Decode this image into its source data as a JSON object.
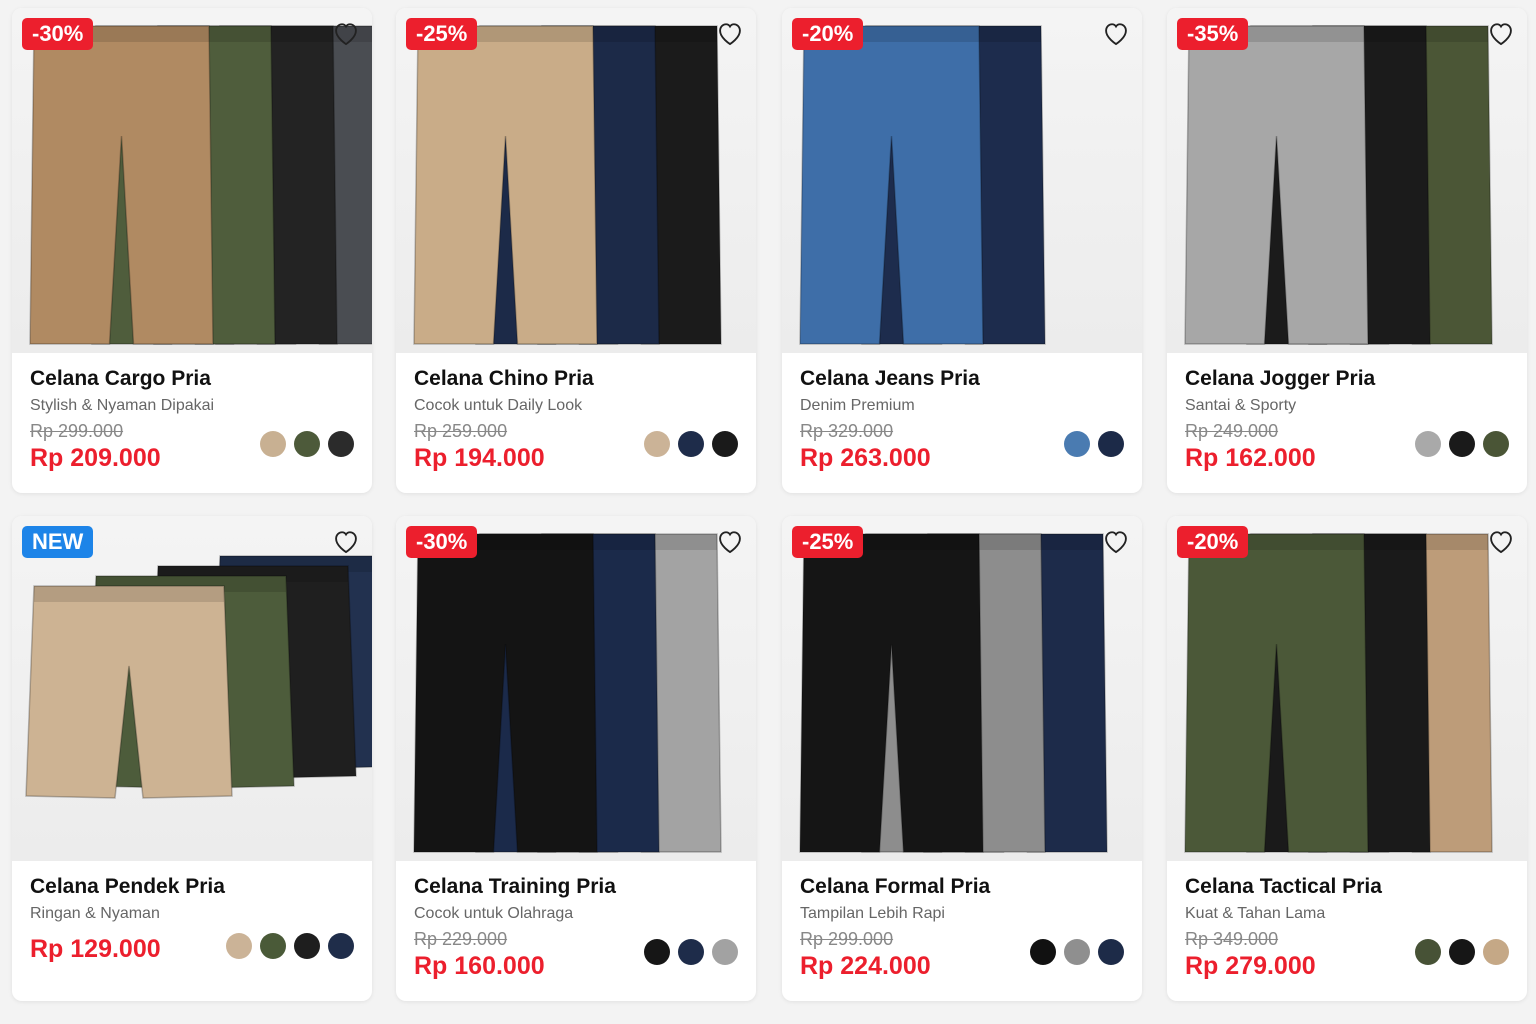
{
  "products": [
    {
      "badge": "-30%",
      "badge_type": "sale",
      "title": "Celana Cargo Pria",
      "subtitle": "Stylish & Nyaman Dipakai",
      "old_price": "Rp 299.000",
      "price": "Rp 209.000",
      "swatches": [
        "#c8b092",
        "#4d5a3a",
        "#2b2b2b"
      ],
      "pant_colors": [
        "#b08a62",
        "#4f5d3c",
        "#232323",
        "#4a4d52"
      ]
    },
    {
      "badge": "-25%",
      "badge_type": "sale",
      "title": "Celana Chino Pria",
      "subtitle": "Cocok untuk Daily Look",
      "old_price": "Rp 259.000",
      "price": "Rp 194.000",
      "swatches": [
        "#cbb397",
        "#1e2c4a",
        "#1a1a1a"
      ],
      "pant_colors": [
        "#c9ac88",
        "#1c2a48",
        "#1b1b1b"
      ]
    },
    {
      "badge": "-20%",
      "badge_type": "sale",
      "title": "Celana Jeans Pria",
      "subtitle": "Denim Premium",
      "old_price": "Rp 329.000",
      "price": "Rp 263.000",
      "swatches": [
        "#4a7bb1",
        "#1c2a48"
      ],
      "pant_colors": [
        "#3e6ea8",
        "#1d2c4d"
      ]
    },
    {
      "badge": "-35%",
      "badge_type": "sale",
      "title": "Celana Jogger Pria",
      "subtitle": "Santai & Sporty",
      "old_price": "Rp 249.000",
      "price": "Rp 162.000",
      "swatches": [
        "#a9a9a9",
        "#1a1a1a",
        "#4a5536"
      ],
      "pant_colors": [
        "#a7a7a7",
        "#1b1b1b",
        "#4b5636"
      ]
    },
    {
      "badge": "NEW",
      "badge_type": "new",
      "title": "Celana Pendek Pria",
      "subtitle": "Ringan & Nyaman",
      "old_price": "",
      "price": "Rp 129.000",
      "swatches": [
        "#cbb397",
        "#4a5a38",
        "#1e1e1e",
        "#1f2d4a"
      ],
      "pant_colors": [
        "#cdb393",
        "#4d5c3b",
        "#1f1f1f",
        "#22314f"
      ]
    },
    {
      "badge": "-30%",
      "badge_type": "sale",
      "title": "Celana Training Pria",
      "subtitle": "Cocok untuk Olahraga",
      "old_price": "Rp 229.000",
      "price": "Rp 160.000",
      "swatches": [
        "#161616",
        "#1e2c4a",
        "#a2a2a2"
      ],
      "pant_colors": [
        "#141414",
        "#1b2a4a",
        "#a3a3a3"
      ]
    },
    {
      "badge": "-25%",
      "badge_type": "sale",
      "title": "Celana Formal Pria",
      "subtitle": "Tampilan Lebih Rapi",
      "old_price": "Rp 299.000",
      "price": "Rp 224.000",
      "swatches": [
        "#111111",
        "#8f8f8f",
        "#1d2b48"
      ],
      "pant_colors": [
        "#151515",
        "#8d8d8d",
        "#1d2b4a"
      ]
    },
    {
      "badge": "-20%",
      "badge_type": "sale",
      "title": "Celana Tactical Pria",
      "subtitle": "Kuat & Tahan Lama",
      "old_price": "Rp 349.000",
      "price": "Rp 279.000",
      "swatches": [
        "#475236",
        "#161616",
        "#c5a886"
      ],
      "pant_colors": [
        "#4b5838",
        "#1a1a1a",
        "#bd9c79"
      ]
    }
  ]
}
